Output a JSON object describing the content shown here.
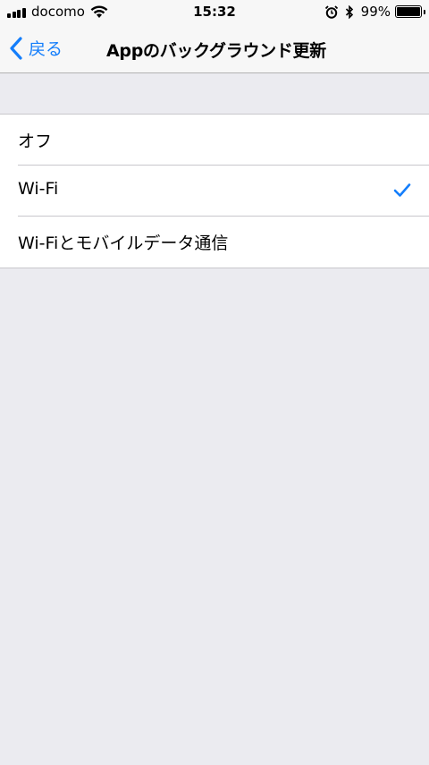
{
  "status_bar": {
    "carrier": "docomo",
    "time": "15:32",
    "battery_percent": "99%",
    "battery_level": 0.99,
    "icons": [
      "signal-icon",
      "wifi-icon",
      "alarm-icon",
      "bluetooth-icon",
      "battery-icon"
    ]
  },
  "nav": {
    "back_label": "戻る",
    "title": "Appのバックグラウンド更新"
  },
  "options": [
    {
      "label": "オフ",
      "selected": false
    },
    {
      "label": "Wi-Fi",
      "selected": true
    },
    {
      "label": "Wi-Fiとモバイルデータ通信",
      "selected": false
    }
  ],
  "colors": {
    "accent": "#147efb",
    "background": "#ebebf0",
    "bar": "#f7f7f7"
  }
}
